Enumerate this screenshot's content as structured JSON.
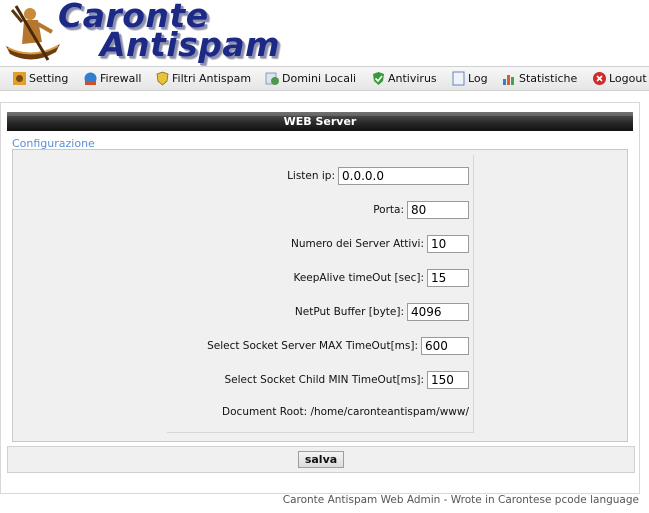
{
  "logo": {
    "line1": "Caronte",
    "line2": "Antispam"
  },
  "menu": [
    {
      "label": "Setting",
      "icon": "settings-icon"
    },
    {
      "label": "Firewall",
      "icon": "firewall-icon"
    },
    {
      "label": "Filtri Antispam",
      "icon": "shield-icon"
    },
    {
      "label": "Domini Locali",
      "icon": "globe-icon"
    },
    {
      "label": "Antivirus",
      "icon": "antivirus-icon"
    },
    {
      "label": "Log",
      "icon": "document-icon"
    },
    {
      "label": "Statistiche",
      "icon": "chart-icon"
    },
    {
      "label": "Logout",
      "icon": "logout-icon"
    }
  ],
  "section_title": "WEB Server",
  "config_link": "Configurazione",
  "form": {
    "listen_ip": {
      "label": "Listen ip:",
      "value": "0.0.0.0"
    },
    "porta": {
      "label": "Porta:",
      "value": "80"
    },
    "numero_server": {
      "label": "Numero dei Server Attivi:",
      "value": "10"
    },
    "keepalive": {
      "label": "KeepAlive timeOut [sec]:",
      "value": "15"
    },
    "netput": {
      "label": "NetPut Buffer [byte]:",
      "value": "4096"
    },
    "select_server": {
      "label": "Select Socket Server MAX TimeOut[ms]:",
      "value": "600"
    },
    "select_child": {
      "label": "Select Socket Child MIN TimeOut[ms]:",
      "value": "150"
    },
    "document_root": "Document Root: /home/caronteantispam/www/"
  },
  "save_label": "salva",
  "footer": "Caronte Antispam Web Admin - Wrote in Carontese pcode language",
  "colors": {
    "logo": "#1c2a86",
    "header_bar": "#222222",
    "link": "#5b8fd6",
    "panel": "#f0f0f0"
  }
}
